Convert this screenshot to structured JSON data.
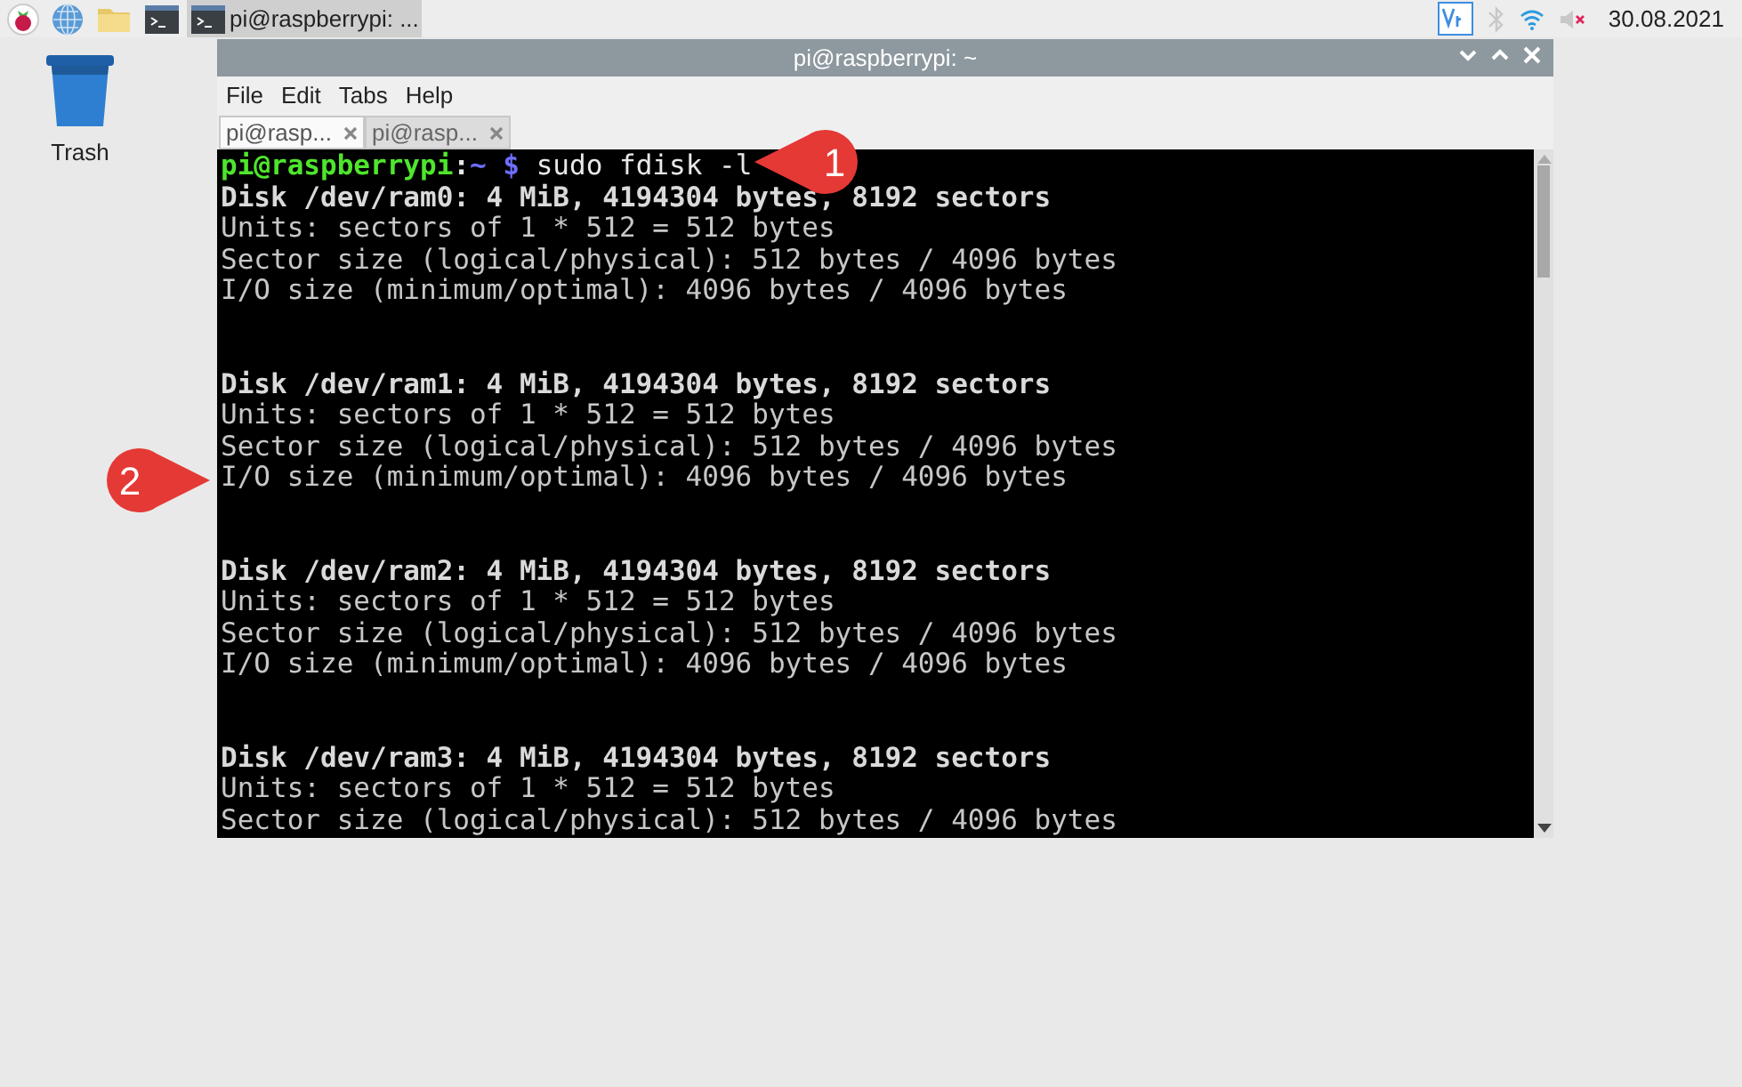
{
  "taskbar": {
    "launchers": [
      {
        "kind": "raspberry"
      },
      {
        "kind": "globe"
      },
      {
        "kind": "folder"
      },
      {
        "kind": "terminal"
      }
    ],
    "tasks": [
      {
        "label": "pi@raspberrypi: ...",
        "selected": true
      }
    ],
    "tray": {
      "date": "30.08.2021"
    }
  },
  "desktop": {
    "icons": [
      {
        "label": "Trash"
      }
    ]
  },
  "window": {
    "title": "pi@raspberrypi: ~",
    "menu": [
      "File",
      "Edit",
      "Tabs",
      "Help"
    ],
    "tabs": [
      {
        "label": "pi@rasp...",
        "selected": true
      },
      {
        "label": "pi@rasp...",
        "selected": false
      }
    ],
    "terminal": {
      "prompt": {
        "user": "pi@raspberrypi",
        "separator": ":",
        "path": "~ $",
        "command": "sudo fdisk -l"
      },
      "blocks": [
        {
          "lines": [
            {
              "text": "Disk /dev/ram0: 4 MiB, 4194304 bytes, 8192 sectors",
              "bold": true
            },
            {
              "text": "Units: sectors of 1 * 512 = 512 bytes",
              "bold": false
            },
            {
              "text": "Sector size (logical/physical): 512 bytes / 4096 bytes",
              "bold": false
            },
            {
              "text": "I/O size (minimum/optimal): 4096 bytes / 4096 bytes",
              "bold": false
            }
          ]
        },
        {
          "lines": [
            {
              "text": "Disk /dev/ram1: 4 MiB, 4194304 bytes, 8192 sectors",
              "bold": true
            },
            {
              "text": "Units: sectors of 1 * 512 = 512 bytes",
              "bold": false
            },
            {
              "text": "Sector size (logical/physical): 512 bytes / 4096 bytes",
              "bold": false
            },
            {
              "text": "I/O size (minimum/optimal): 4096 bytes / 4096 bytes",
              "bold": false
            }
          ]
        },
        {
          "lines": [
            {
              "text": "Disk /dev/ram2: 4 MiB, 4194304 bytes, 8192 sectors",
              "bold": true
            },
            {
              "text": "Units: sectors of 1 * 512 = 512 bytes",
              "bold": false
            },
            {
              "text": "Sector size (logical/physical): 512 bytes / 4096 bytes",
              "bold": false
            },
            {
              "text": "I/O size (minimum/optimal): 4096 bytes / 4096 bytes",
              "bold": false
            }
          ]
        },
        {
          "lines": [
            {
              "text": "Disk /dev/ram3: 4 MiB, 4194304 bytes, 8192 sectors",
              "bold": true
            },
            {
              "text": "Units: sectors of 1 * 512 = 512 bytes",
              "bold": false
            },
            {
              "text": "Sector size (logical/physical): 512 bytes / 4096 bytes",
              "bold": false
            }
          ]
        }
      ]
    }
  },
  "callouts": [
    {
      "label": "1",
      "kind": "left"
    },
    {
      "label": "2",
      "kind": "right"
    }
  ]
}
